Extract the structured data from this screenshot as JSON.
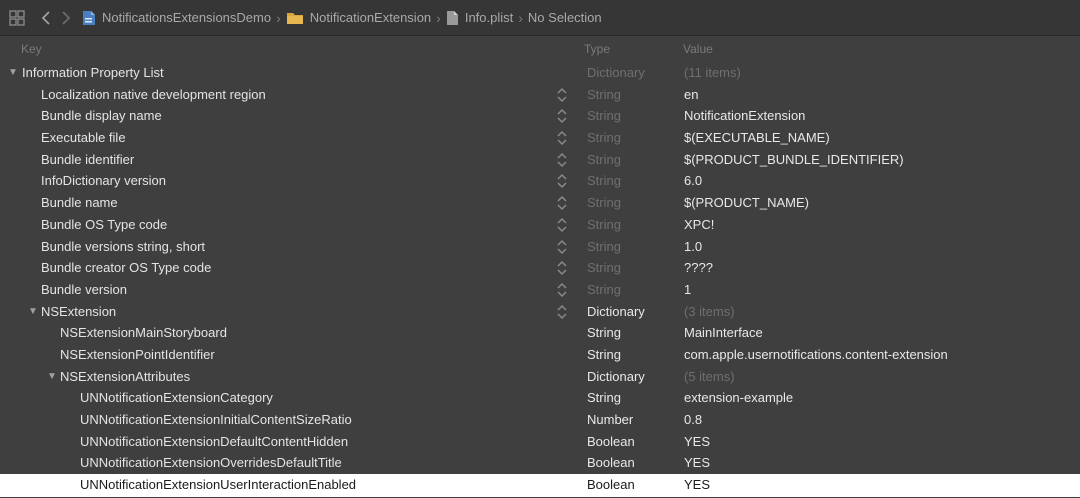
{
  "jumpbar": {
    "crumbs": [
      {
        "label": "NotificationsExtensionsDemo",
        "icon": "project-file-icon"
      },
      {
        "label": "NotificationExtension",
        "icon": "folder-icon"
      },
      {
        "label": "Info.plist",
        "icon": "document-icon"
      },
      {
        "label": "No Selection",
        "icon": ""
      }
    ]
  },
  "header": {
    "key": "Key",
    "type": "Type",
    "value": "Value"
  },
  "rows": [
    {
      "key": "Information Property List",
      "type": "Dictionary",
      "value": "(11 items)",
      "type_dim": true,
      "value_dim": true
    },
    {
      "key": "Localization native development region",
      "type": "String",
      "value": "en",
      "type_dim": true
    },
    {
      "key": "Bundle display name",
      "type": "String",
      "value": "NotificationExtension",
      "type_dim": true
    },
    {
      "key": "Executable file",
      "type": "String",
      "value": "$(EXECUTABLE_NAME)",
      "type_dim": true
    },
    {
      "key": "Bundle identifier",
      "type": "String",
      "value": "$(PRODUCT_BUNDLE_IDENTIFIER)",
      "type_dim": true
    },
    {
      "key": "InfoDictionary version",
      "type": "String",
      "value": "6.0",
      "type_dim": true
    },
    {
      "key": "Bundle name",
      "type": "String",
      "value": "$(PRODUCT_NAME)",
      "type_dim": true
    },
    {
      "key": "Bundle OS Type code",
      "type": "String",
      "value": "XPC!",
      "type_dim": true
    },
    {
      "key": "Bundle versions string, short",
      "type": "String",
      "value": "1.0",
      "type_dim": true
    },
    {
      "key": "Bundle creator OS Type code",
      "type": "String",
      "value": "????",
      "type_dim": true
    },
    {
      "key": "Bundle version",
      "type": "String",
      "value": "1",
      "type_dim": true
    },
    {
      "key": "NSExtension",
      "type": "Dictionary",
      "value": "(3 items)",
      "value_dim": true
    },
    {
      "key": "NSExtensionMainStoryboard",
      "type": "String",
      "value": "MainInterface"
    },
    {
      "key": "NSExtensionPointIdentifier",
      "type": "String",
      "value": "com.apple.usernotifications.content-extension"
    },
    {
      "key": "NSExtensionAttributes",
      "type": "Dictionary",
      "value": "(5 items)",
      "value_dim": true
    },
    {
      "key": "UNNotificationExtensionCategory",
      "type": "String",
      "value": "extension-example"
    },
    {
      "key": "UNNotificationExtensionInitialContentSizeRatio",
      "type": "Number",
      "value": "0.8"
    },
    {
      "key": "UNNotificationExtensionDefaultContentHidden",
      "type": "Boolean",
      "value": "YES"
    },
    {
      "key": "UNNotificationExtensionOverridesDefaultTitle",
      "type": "Boolean",
      "value": "YES"
    },
    {
      "key": "UNNotificationExtensionUserInteractionEnabled",
      "type": "Boolean",
      "value": "YES"
    }
  ]
}
